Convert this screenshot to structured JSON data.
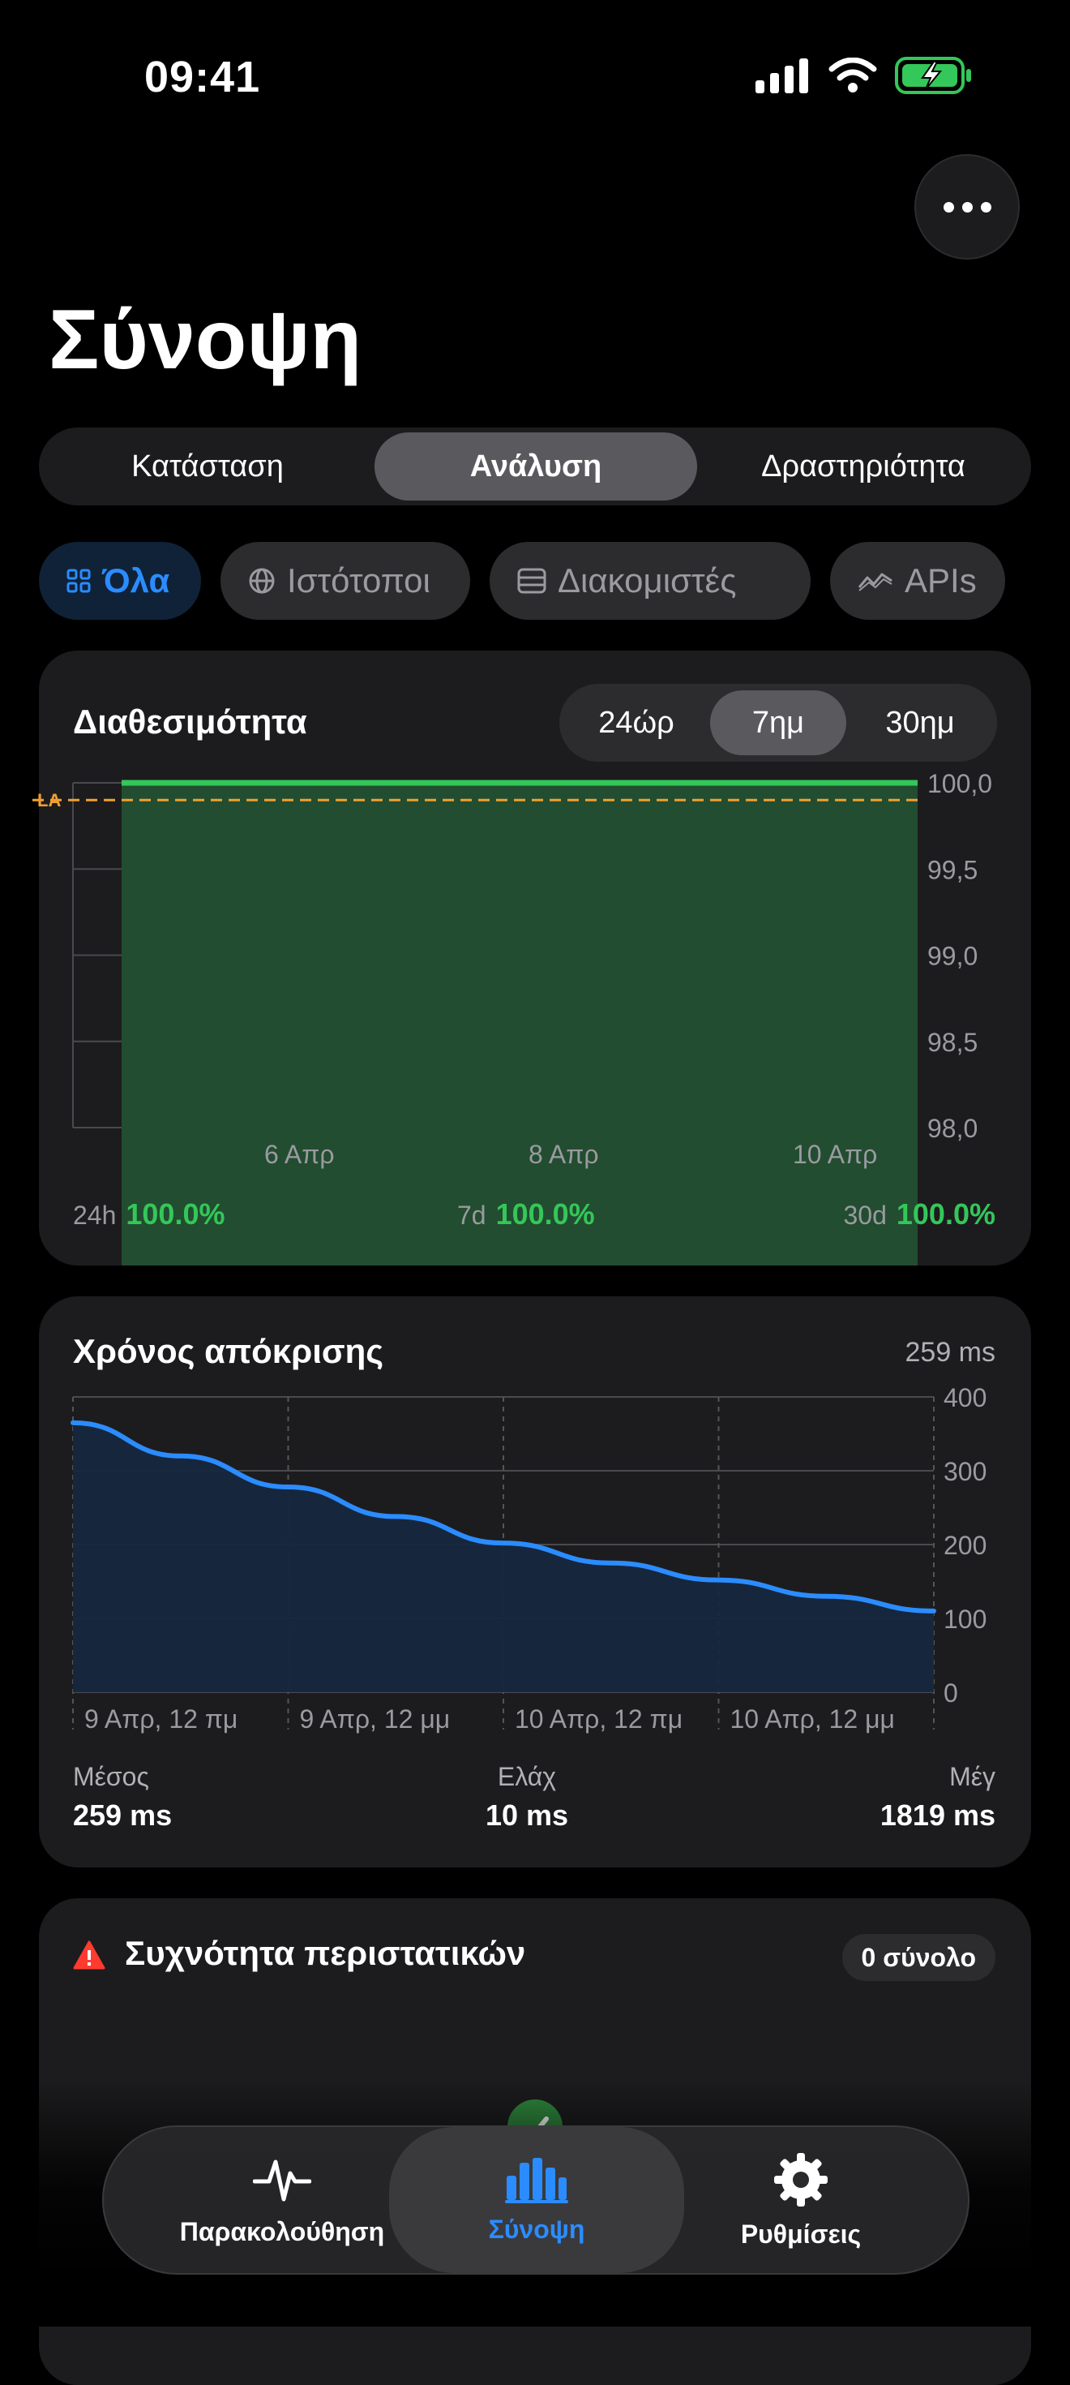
{
  "status_bar": {
    "time": "09:41"
  },
  "header": {
    "title": "Σύνοψη",
    "more_icon": "ellipsis-icon"
  },
  "segment": {
    "tabs": [
      "Κατάσταση",
      "Ανάλυση",
      "Δραστηριότητα"
    ],
    "selected": "Ανάλυση"
  },
  "filters": [
    {
      "label": "Όλα",
      "icon": "grid-icon",
      "selected": true
    },
    {
      "label": "Ιστότοποι",
      "icon": "globe-icon",
      "selected": false
    },
    {
      "label": "Διακομιστές",
      "icon": "server-icon",
      "selected": false
    },
    {
      "label": "APIs",
      "icon": "wave-icon",
      "selected": false
    }
  ],
  "availability": {
    "title": "Διαθεσιμότητα",
    "ranges": [
      "24ώρ",
      "7ημ",
      "30ημ"
    ],
    "selected_range": "7ημ",
    "sla_label": "LA",
    "summary": [
      {
        "label": "24h",
        "value": "100.0%"
      },
      {
        "label": "7d",
        "value": "100.0%"
      },
      {
        "label": "30d",
        "value": "100.0%"
      }
    ]
  },
  "response": {
    "title": "Χρόνος απόκρισης",
    "current": "259 ms",
    "stats": [
      {
        "label": "Μέσος",
        "value": "259 ms"
      },
      {
        "label": "Ελάχ",
        "value": "10 ms"
      },
      {
        "label": "Μέγ",
        "value": "1819 ms"
      }
    ]
  },
  "incidents": {
    "title": "Συχνότητα περιστατικών",
    "badge": "0 σύνολο"
  },
  "tabbar": {
    "items": [
      {
        "label": "Παρακολούθηση",
        "icon": "heartbeat-icon"
      },
      {
        "label": "Σύνοψη",
        "icon": "bar-chart-icon"
      },
      {
        "label": "Ρυθμίσεις",
        "icon": "gear-icon"
      }
    ],
    "selected": "Σύνοψη"
  },
  "colors": {
    "accent": "#2b8cff",
    "green": "#34c759",
    "sla": "#f0a030",
    "card": "#1c1c1e"
  },
  "chart_data": [
    {
      "type": "area",
      "x_ticks": [
        "6 Απρ",
        "8 Απρ",
        "10 Απρ"
      ],
      "y_ticks": [
        "100,0",
        "99,5",
        "99,0",
        "98,5",
        "98,0"
      ],
      "ylim": [
        98.0,
        100.0
      ],
      "series": [
        {
          "values": [
            100.0,
            100.0
          ]
        }
      ],
      "sla_value": 99.9,
      "grid": true
    },
    {
      "type": "area",
      "x_ticks": [
        "9 Απρ, 12 πμ",
        "9 Απρ, 12 μμ",
        "10 Απρ, 12 πμ",
        "10 Απρ, 12 μμ"
      ],
      "y_ticks": [
        "400",
        "300",
        "200",
        "100",
        "0"
      ],
      "ylim": [
        0,
        400
      ],
      "series": [
        {
          "values": [
            365,
            320,
            278,
            238,
            202,
            175,
            152,
            130,
            110
          ]
        }
      ],
      "grid": true
    }
  ]
}
